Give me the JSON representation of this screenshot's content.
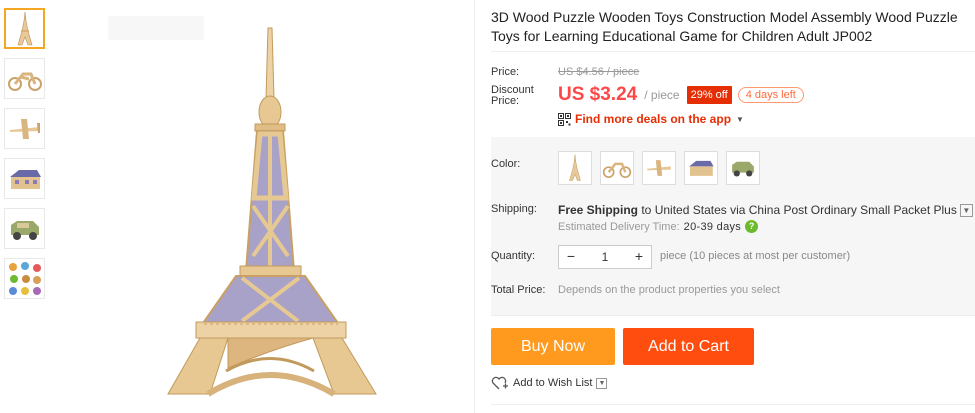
{
  "product": {
    "title": "3D Wood Puzzle Wooden Toys Construction Model Assembly Wood Puzzle Toys for Learning Educational Game for Children Adult JP002"
  },
  "thumbnails": [
    {
      "icon": "eiffel-tower-icon"
    },
    {
      "icon": "motorcycle-icon"
    },
    {
      "icon": "airplane-icon"
    },
    {
      "icon": "house-icon"
    },
    {
      "icon": "jeep-icon"
    },
    {
      "icon": "animals-collage-icon"
    }
  ],
  "price": {
    "label": "Price:",
    "original": "US $4.56 / piece",
    "discount_label_1": "Discount",
    "discount_label_2": "Price:",
    "current": "US $3.24",
    "unit": "/ piece",
    "badge": "29% off",
    "days_left": "4 days left",
    "deals_text": "Find more deals on the app"
  },
  "color": {
    "label": "Color:",
    "options": [
      "eiffel-tower-icon",
      "motorcycle-icon",
      "airplane-icon",
      "house-icon",
      "jeep-icon"
    ]
  },
  "shipping": {
    "label": "Shipping:",
    "free": "Free Shipping",
    "to": " to ",
    "country": "United States",
    "via": " via ",
    "carrier": "China Post Ordinary Small Packet Plus",
    "eta_label": "Estimated Delivery Time:",
    "eta_days": "20-39 days"
  },
  "quantity": {
    "label": "Quantity:",
    "value": "1",
    "minus": "−",
    "plus": "+",
    "note": "piece (10 pieces at most per customer)"
  },
  "total": {
    "label": "Total Price:",
    "value": "Depends on the product properties you select"
  },
  "actions": {
    "buy_now": "Buy Now",
    "add_to_cart": "Add to Cart",
    "wishlist": "Add to Wish List"
  },
  "colors": {
    "accent": "#ff4747",
    "buy": "#ff9a1f",
    "cart": "#ff4c0f",
    "thumb_active": "#f5a623"
  }
}
